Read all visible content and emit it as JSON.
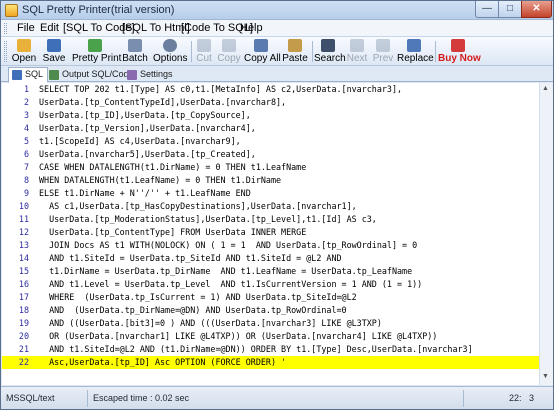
{
  "window": {
    "title": "SQL Pretty Printer(trial version)"
  },
  "menu": [
    {
      "label": "File"
    },
    {
      "label": "Edit"
    },
    {
      "label": "[SQL To Code]"
    },
    {
      "label": "[SQL To Html]"
    },
    {
      "label": "[Code To SQL]"
    },
    {
      "label": "Help"
    }
  ],
  "toolbar": [
    {
      "label": "Open",
      "icon": "folder-open-icon",
      "color": "#e9b13a",
      "enabled": true
    },
    {
      "label": "Save",
      "icon": "save-disk-icon",
      "color": "#3f6fb8",
      "enabled": true
    },
    {
      "label": "Pretty Print",
      "icon": "pretty-print-icon",
      "color": "#4aa34a",
      "enabled": true
    },
    {
      "label": "Batch",
      "icon": "batch-icon",
      "color": "#7a8fb0",
      "enabled": true
    },
    {
      "label": "Options",
      "icon": "options-gear-icon",
      "color": "#6b7f9e",
      "enabled": true
    },
    {
      "label": "Cut",
      "icon": "scissors-icon",
      "color": "#6a7f9c",
      "enabled": false
    },
    {
      "label": "Copy",
      "icon": "copy-icon",
      "color": "#6a7f9c",
      "enabled": false
    },
    {
      "label": "Copy All",
      "icon": "copy-all-icon",
      "color": "#5a7bb0",
      "enabled": true
    },
    {
      "label": "Paste",
      "icon": "paste-clipboard-icon",
      "color": "#c49a4b",
      "enabled": true
    },
    {
      "label": "Search",
      "icon": "search-binoculars-icon",
      "color": "#3d4f6b",
      "enabled": true
    },
    {
      "label": "Next",
      "icon": "next-arrow-icon",
      "color": "#6a7f9c",
      "enabled": false
    },
    {
      "label": "Prev",
      "icon": "prev-arrow-icon",
      "color": "#6a7f9c",
      "enabled": false
    },
    {
      "label": "Replace",
      "icon": "replace-icon",
      "color": "#4f79b8",
      "enabled": true
    },
    {
      "label": "Buy Now",
      "icon": "buy-now-icon",
      "color": "#d43c3c",
      "enabled": true
    }
  ],
  "tabs": [
    {
      "label": "SQL",
      "icon": "sql-doc-icon",
      "color": "#3f6fb8",
      "active": true
    },
    {
      "label": "Output SQL/Code",
      "icon": "output-icon",
      "color": "#4f8a4f",
      "active": false
    },
    {
      "label": "Settings",
      "icon": "settings-icon",
      "color": "#8a6bb0",
      "active": false
    }
  ],
  "editor": {
    "highlight_color": "#ffff00",
    "lines": [
      {
        "no": "1",
        "text": "SELECT TOP 202 t1.[Type] AS c0,t1.[MetaInfo] AS c2,UserData.[nvarchar3],"
      },
      {
        "no": "2",
        "text": "UserData.[tp_ContentTypeId],UserData.[nvarchar8],"
      },
      {
        "no": "3",
        "text": "UserData.[tp_ID],UserData.[tp_CopySource],"
      },
      {
        "no": "4",
        "text": "UserData.[tp_Version],UserData.[nvarchar4],"
      },
      {
        "no": "5",
        "text": "t1.[ScopeId] AS c4,UserData.[nvarchar9],"
      },
      {
        "no": "6",
        "text": "UserData.[nvarchar5],UserData.[tp_Created],"
      },
      {
        "no": "7",
        "text": "CASE WHEN DATALENGTH(t1.DirName) = 0 THEN t1.LeafName"
      },
      {
        "no": "8",
        "text": "WHEN DATALENGTH(t1.LeafName) = 0 THEN t1.DirName"
      },
      {
        "no": "9",
        "text": "ELSE t1.DirName + N''/'' + t1.LeafName END"
      },
      {
        "no": "10",
        "text": "  AS c1,UserData.[tp_HasCopyDestinations],UserData.[nvarchar1],"
      },
      {
        "no": "11",
        "text": "  UserData.[tp_ModerationStatus],UserData.[tp_Level],t1.[Id] AS c3,"
      },
      {
        "no": "12",
        "text": "  UserData.[tp_ContentType] FROM UserData INNER MERGE"
      },
      {
        "no": "13",
        "text": "  JOIN Docs AS t1 WITH(NOLOCK) ON ( 1 = 1  AND UserData.[tp_RowOrdinal] = 0"
      },
      {
        "no": "14",
        "text": "  AND t1.SiteId = UserData.tp_SiteId AND t1.SiteId = @L2 AND"
      },
      {
        "no": "15",
        "text": "  t1.DirName = UserData.tp_DirName  AND t1.LeafName = UserData.tp_LeafName"
      },
      {
        "no": "16",
        "text": "  AND t1.Level = UserData.tp_Level  AND t1.IsCurrentVersion = 1 AND (1 = 1))"
      },
      {
        "no": "17",
        "text": "  WHERE  (UserData.tp_IsCurrent = 1) AND UserData.tp_SiteId=@L2"
      },
      {
        "no": "18",
        "text": "  AND  (UserData.tp_DirName=@DN) AND UserData.tp_RowOrdinal=0"
      },
      {
        "no": "19",
        "text": "  AND ((UserData.[bit3]=0 ) AND (((UserData.[nvarchar3] LIKE @L3TXP)"
      },
      {
        "no": "20",
        "text": "  OR (UserData.[nvarchar1] LIKE @L4TXP)) OR (UserData.[nvarchar4] LIKE @L4TXP))"
      },
      {
        "no": "21",
        "text": "  AND t1.SiteId=@L2 AND (t1.DirName=@DN)) ORDER BY t1.[Type] Desc,UserData.[nvarchar3]"
      },
      {
        "no": "22",
        "text": "  Asc,UserData.[tp_ID] Asc OPTION (FORCE ORDER) '",
        "highlight": true
      }
    ]
  },
  "status": {
    "mode": "MSSQL/text",
    "escaped_time": "Escaped time : 0.02 sec",
    "cursor": "22:   3"
  }
}
